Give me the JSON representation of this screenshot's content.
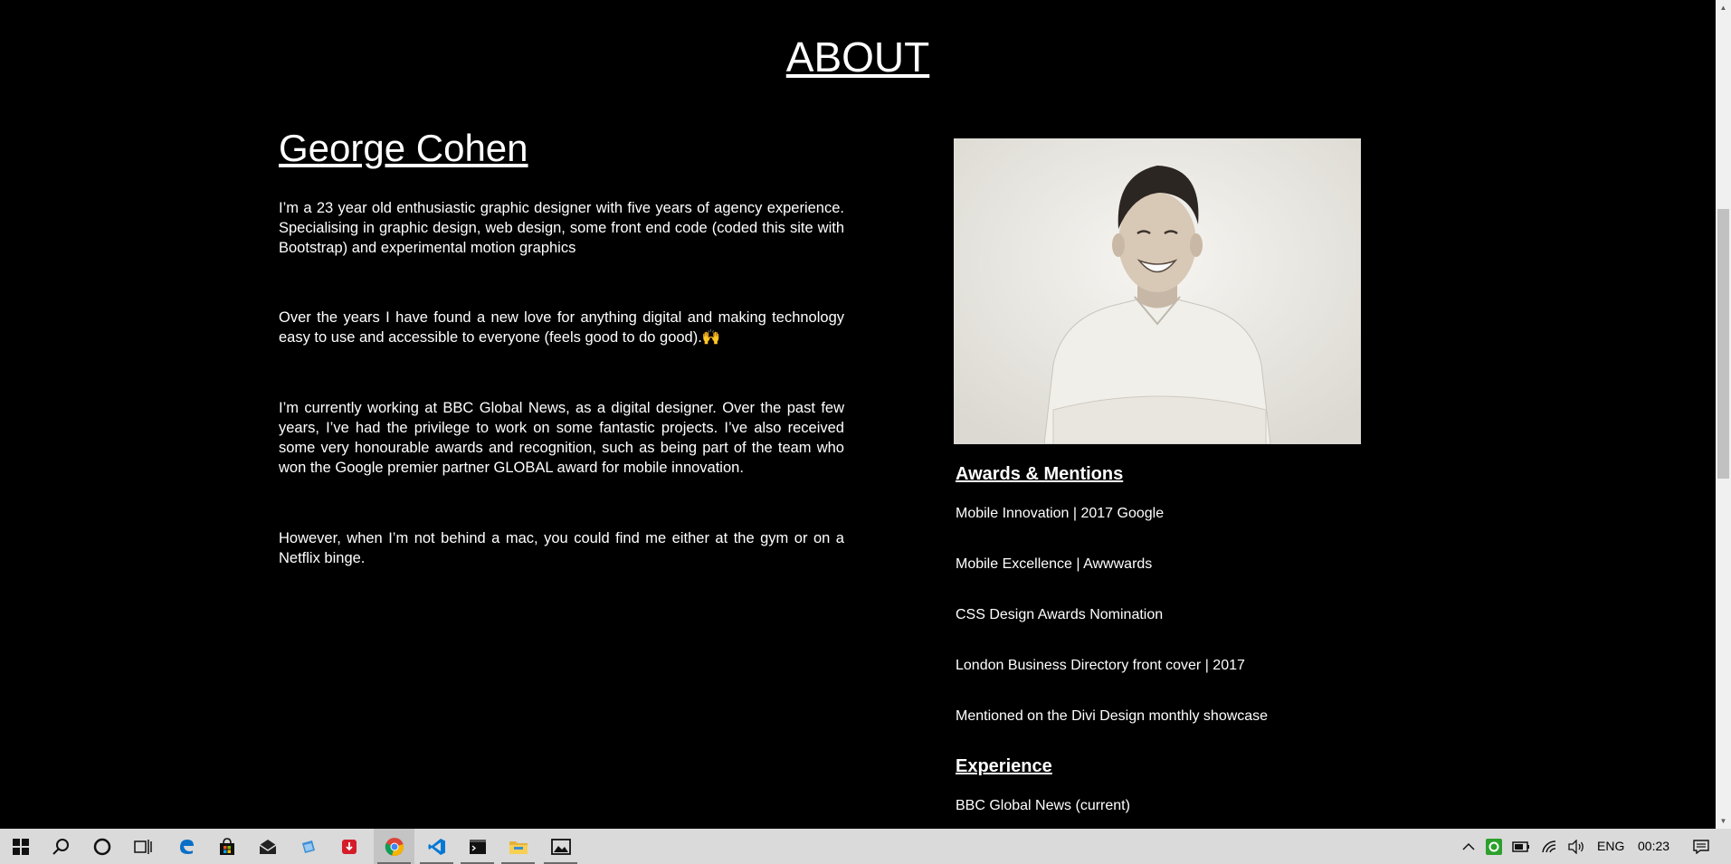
{
  "page": {
    "title": "ABOUT",
    "name": "George Cohen",
    "bio": [
      "I’m a 23 year old enthusiastic graphic designer with five years of agency experience. Specialising in graphic design, web design, some front end code (coded this site with Bootstrap) and experimental motion graphics",
      "Over the years I have found a new love for anything digital and making technology easy to use and accessible to everyone (feels good to do good).🙌",
      "I’m currently working at BBC Global News, as a digital designer. Over the past few years, I’ve had the privilege to work on some fantastic projects. I’ve also received some very honourable awards and recognition, such as being part of the team who won the Google premier partner GLOBAL award for mobile innovation.",
      "However, when I’m not behind a mac, you could find me either at the gym or on a Netflix binge."
    ],
    "awards_heading": "Awards & Mentions",
    "awards": [
      "Mobile Innovation | 2017 Google",
      "Mobile Excellence | Awwwards",
      "CSS Design Awards Nomination",
      "London Business Directory front cover | 2017",
      "Mentioned on the Divi Design monthly showcase"
    ],
    "experience_heading": "Experience",
    "experience": [
      "BBC Global News (current)"
    ]
  },
  "taskbar": {
    "icons": [
      "windows-start-icon",
      "search-icon",
      "cortana-icon",
      "task-view-icon",
      "edge-icon",
      "store-icon",
      "mail-icon",
      "paint-icon",
      "pdf-icon",
      "chrome-icon",
      "vscode-icon",
      "terminal-icon",
      "file-explorer-icon",
      "photos-icon"
    ],
    "language": "ENG",
    "time": "00:23"
  },
  "colors": {
    "background": "#000000",
    "text": "#ffffff",
    "taskbar": "#dadada",
    "chrome_red": "#db4437",
    "chrome_yellow": "#f4b400",
    "chrome_green": "#0f9d58",
    "vscode_blue": "#0078d4"
  }
}
